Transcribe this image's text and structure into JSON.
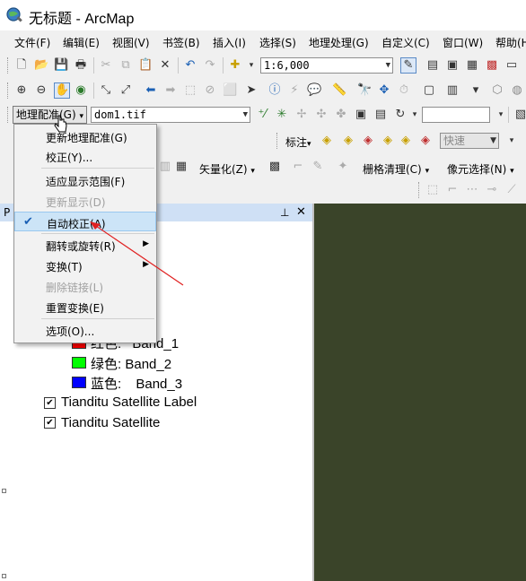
{
  "window": {
    "title": "无标题 - ArcMap",
    "app_icon": "arcmap-globe-icon"
  },
  "menubar": [
    {
      "label": "文件(F)"
    },
    {
      "label": "编辑(E)"
    },
    {
      "label": "视图(V)"
    },
    {
      "label": "书签(B)"
    },
    {
      "label": "插入(I)"
    },
    {
      "label": "选择(S)"
    },
    {
      "label": "地理处理(G)"
    },
    {
      "label": "自定义(C)"
    },
    {
      "label": "窗口(W)"
    },
    {
      "label": "帮助(H)"
    }
  ],
  "standard_toolbar": {
    "scale": "1:6,000"
  },
  "georef_toolbar": {
    "menu_label": "地理配准(G)",
    "layer": "dom1.tif"
  },
  "label_toolbar": {
    "label_menu": "标注",
    "speed": "快速"
  },
  "raster_toolbar": {
    "vectorize": "矢量化(Z)",
    "raster_cleanup": "栅格清理(C)",
    "pixel_select": "像元选择(N)"
  },
  "toc": {
    "header_letter": "P",
    "pin_icon": "pin-icon",
    "close_icon": "close-icon",
    "bands": [
      {
        "label": "红色:",
        "band": "Band_1",
        "color": "#ff0000"
      },
      {
        "label": "绿色:",
        "band": "Band_2",
        "color": "#00ff00"
      },
      {
        "label": "蓝色:",
        "band": "Band_3",
        "color": "#0000ff"
      }
    ],
    "layers": [
      {
        "name": "Tianditu Satellite Label",
        "checked": true
      },
      {
        "name": "Tianditu Satellite",
        "checked": true
      }
    ]
  },
  "dropdown": {
    "items": [
      {
        "label": "更新地理配准(G)",
        "disabled": false
      },
      {
        "label": "校正(Y)...",
        "disabled": false
      },
      {
        "label": "适应显示范围(F)",
        "disabled": false
      },
      {
        "label": "更新显示(D)",
        "disabled": true
      },
      {
        "label": "自动校正(A)",
        "disabled": false,
        "checked": true
      },
      {
        "label": "翻转或旋转(R)",
        "disabled": false,
        "submenu": true
      },
      {
        "label": "变换(T)",
        "disabled": false,
        "submenu": true
      },
      {
        "label": "删除链接(L)",
        "disabled": true
      },
      {
        "label": "重置变换(E)",
        "disabled": false
      },
      {
        "label": "选项(O)...",
        "disabled": false
      }
    ]
  },
  "colors": {
    "map_bg": "#3a4429",
    "accent": "#1a5fb4",
    "arrow": "#e02020"
  }
}
